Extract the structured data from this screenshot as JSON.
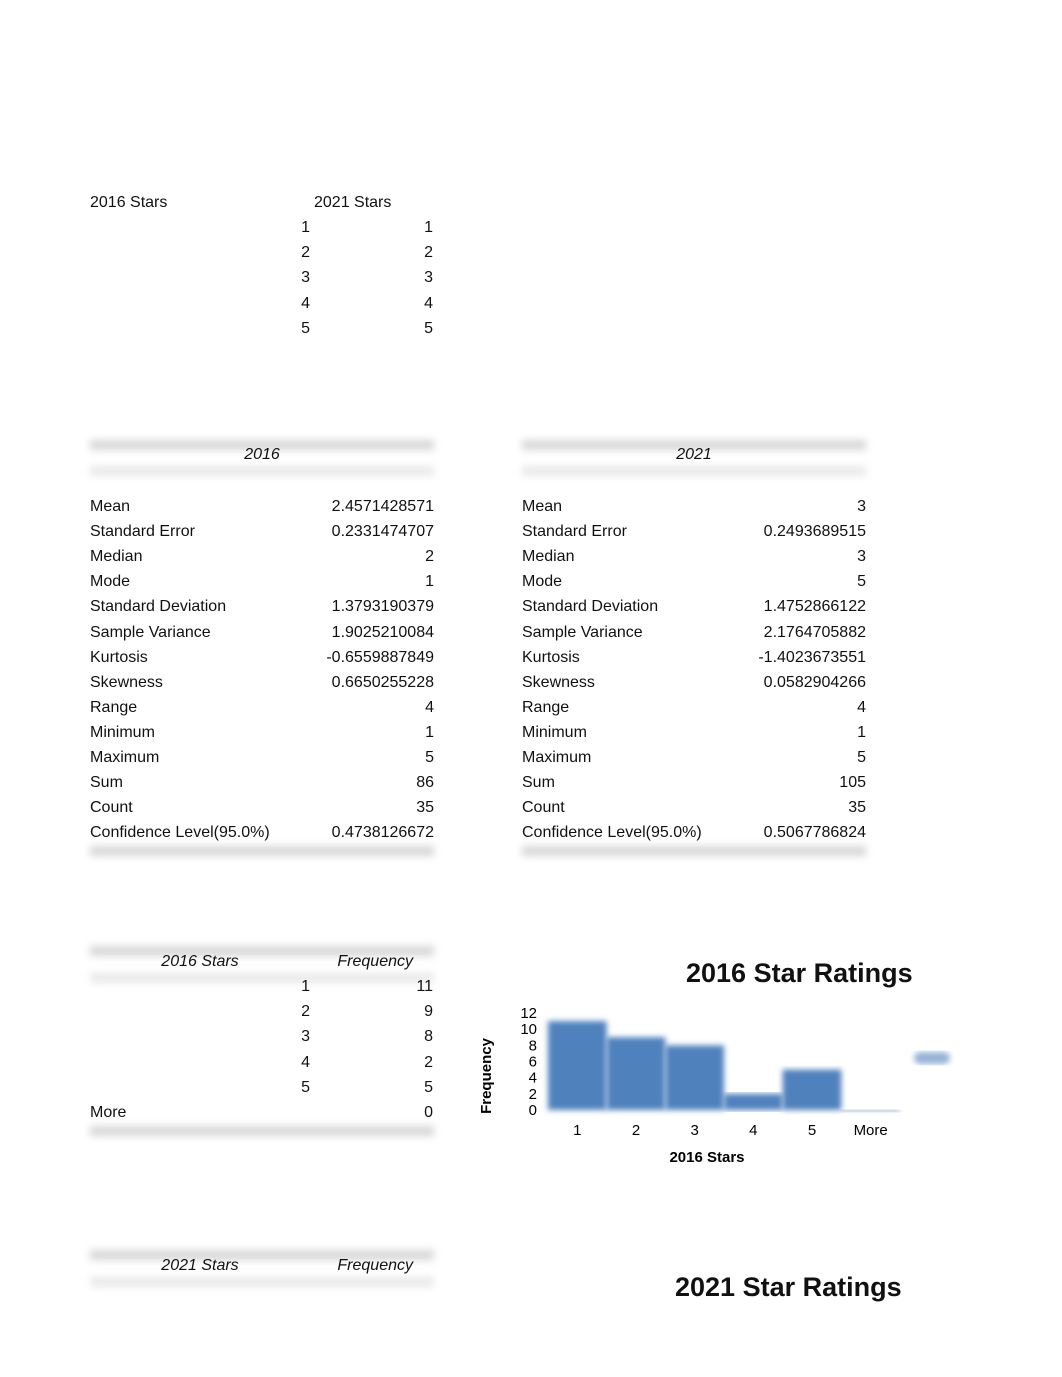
{
  "input_table": {
    "headers": [
      "2016 Stars",
      "2021  Stars"
    ],
    "rows": [
      [
        "1",
        "1"
      ],
      [
        "2",
        "2"
      ],
      [
        "3",
        "3"
      ],
      [
        "4",
        "4"
      ],
      [
        "5",
        "5"
      ]
    ]
  },
  "stats_2016": {
    "title": "2016",
    "rows": [
      [
        "Mean",
        "2.4571428571"
      ],
      [
        "Standard Error",
        "0.2331474707"
      ],
      [
        "Median",
        "2"
      ],
      [
        "Mode",
        "1"
      ],
      [
        "Standard Deviation",
        "1.3793190379"
      ],
      [
        "Sample Variance",
        "1.9025210084"
      ],
      [
        "Kurtosis",
        "-0.6559887849"
      ],
      [
        "Skewness",
        "0.6650255228"
      ],
      [
        "Range",
        "4"
      ],
      [
        "Minimum",
        "1"
      ],
      [
        "Maximum",
        "5"
      ],
      [
        "Sum",
        "86"
      ],
      [
        "Count",
        "35"
      ],
      [
        "Confidence Level(95.0%)",
        "0.4738126672"
      ]
    ]
  },
  "stats_2021": {
    "title": "2021",
    "rows": [
      [
        "Mean",
        "3"
      ],
      [
        "Standard Error",
        "0.2493689515"
      ],
      [
        "Median",
        "3"
      ],
      [
        "Mode",
        "5"
      ],
      [
        "Standard Deviation",
        "1.4752866122"
      ],
      [
        "Sample Variance",
        "2.1764705882"
      ],
      [
        "Kurtosis",
        "-1.4023673551"
      ],
      [
        "Skewness",
        "0.0582904266"
      ],
      [
        "Range",
        "4"
      ],
      [
        "Minimum",
        "1"
      ],
      [
        "Maximum",
        "5"
      ],
      [
        "Sum",
        "105"
      ],
      [
        "Count",
        "35"
      ],
      [
        "Confidence Level(95.0%)",
        "0.5067786824"
      ]
    ]
  },
  "freq_2016": {
    "headers": [
      "2016 Stars",
      "Frequency"
    ],
    "rows": [
      [
        "1",
        "11"
      ],
      [
        "2",
        "9"
      ],
      [
        "3",
        "8"
      ],
      [
        "4",
        "2"
      ],
      [
        "5",
        "5"
      ],
      [
        "More",
        "0"
      ]
    ]
  },
  "freq_2021": {
    "headers": [
      "2021  Stars",
      "Frequency"
    ]
  },
  "chart_2021_title": "2021 Star Ratings",
  "chart_data": {
    "type": "bar",
    "title": "2016 Star Ratings",
    "xlabel": "2016 Stars",
    "ylabel": "Frequency",
    "categories": [
      "1",
      "2",
      "3",
      "4",
      "5",
      "More"
    ],
    "values": [
      11,
      9,
      8,
      2,
      5,
      0
    ],
    "ylim": [
      0,
      12
    ],
    "yticks": [
      "0",
      "2",
      "4",
      "6",
      "8",
      "10",
      "12"
    ],
    "grid": false,
    "legend": "right",
    "bar_color": "#4f81bd"
  }
}
